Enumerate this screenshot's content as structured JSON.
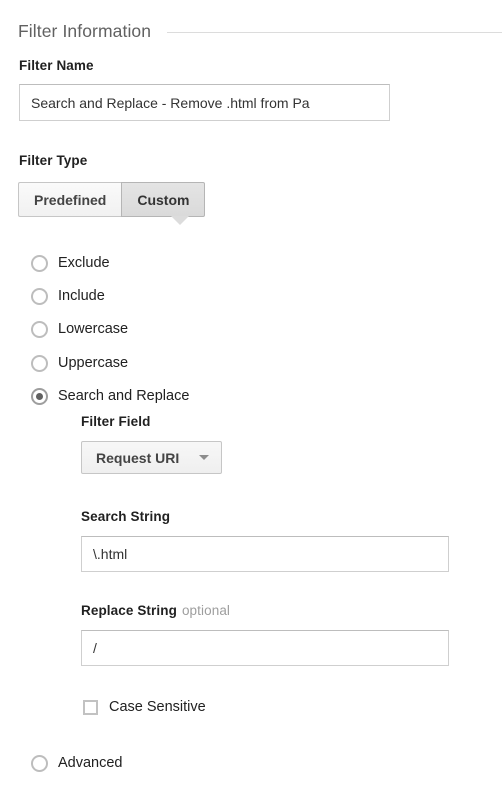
{
  "section": {
    "title": "Filter Information"
  },
  "filter_name": {
    "label": "Filter Name",
    "value": "Search and Replace - Remove .html from Pa",
    "placeholder": ""
  },
  "filter_type": {
    "label": "Filter Type",
    "tabs": [
      {
        "label": "Predefined",
        "selected": false
      },
      {
        "label": "Custom",
        "selected": true
      }
    ]
  },
  "custom_options": {
    "radios": [
      {
        "label": "Exclude",
        "selected": false
      },
      {
        "label": "Include",
        "selected": false
      },
      {
        "label": "Lowercase",
        "selected": false
      },
      {
        "label": "Uppercase",
        "selected": false
      },
      {
        "label": "Search and Replace",
        "selected": true
      },
      {
        "label": "Advanced",
        "selected": false
      }
    ]
  },
  "search_and_replace": {
    "filter_field": {
      "label": "Filter Field",
      "selected_value": "Request URI",
      "caret_icon": "chevron-down-icon"
    },
    "search_string": {
      "label": "Search String",
      "value": "\\.html",
      "placeholder": ""
    },
    "replace_string": {
      "label": "Replace String",
      "optional_hint": "optional",
      "value": "/",
      "placeholder": ""
    },
    "case_sensitive": {
      "label": "Case Sensitive",
      "checked": false
    }
  },
  "colors": {
    "text_primary": "#212121",
    "text_muted": "#9e9e9e",
    "header_text": "#616161",
    "rule": "#dcdcdc",
    "input_border": "#cfcfcf",
    "tab_selected_bg": "#dadada",
    "tab_bg": "#f1f1f1"
  }
}
